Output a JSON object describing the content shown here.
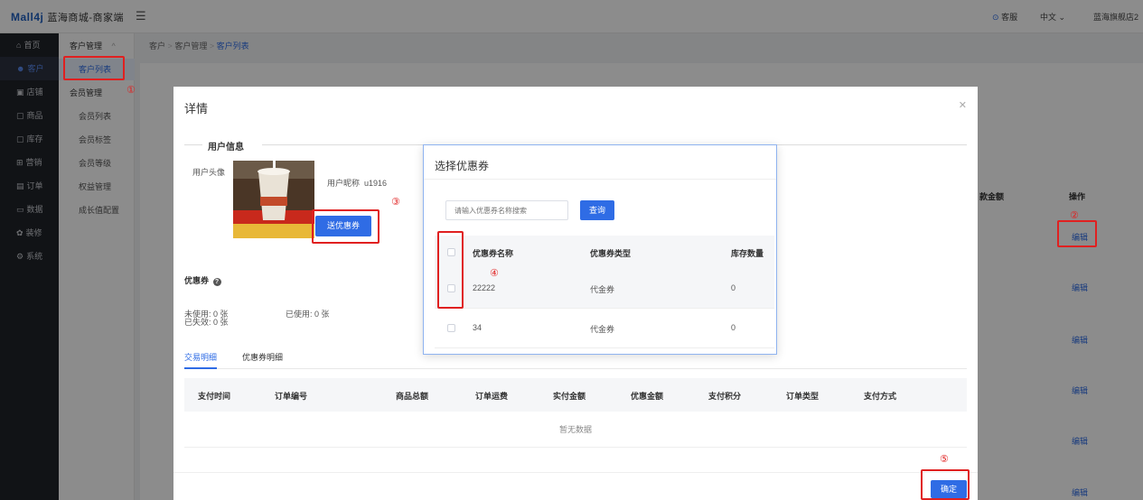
{
  "header": {
    "logo": "Mall4j",
    "app_name": "蓝海商城-商家端",
    "menu_icon": "hamburger-icon",
    "service": "客服",
    "language": "中文",
    "store": "蓝海旗舰店2"
  },
  "sidebar": {
    "items": [
      {
        "label": "首页",
        "icon": "home-icon"
      },
      {
        "label": "客户",
        "icon": "user-icon"
      },
      {
        "label": "店铺",
        "icon": "store-icon"
      },
      {
        "label": "商品",
        "icon": "goods-icon"
      },
      {
        "label": "库存",
        "icon": "stock-icon"
      },
      {
        "label": "营销",
        "icon": "gift-icon"
      },
      {
        "label": "订单",
        "icon": "order-icon"
      },
      {
        "label": "数据",
        "icon": "chart-icon"
      },
      {
        "label": "装修",
        "icon": "decorate-icon"
      },
      {
        "label": "系统",
        "icon": "settings-icon"
      }
    ]
  },
  "submenu": {
    "customer_manage": "客户管理",
    "customer_list": "客户列表",
    "member_manage": "会员管理",
    "member_list": "会员列表",
    "member_tags": "会员标签",
    "member_levels": "会员等级",
    "rights": "权益管理",
    "growth": "成长值配置"
  },
  "breadcrumb": [
    "客户",
    "客户管理",
    "客户列表"
  ],
  "background_table": {
    "amount_header": "款金额",
    "action_header": "操作",
    "edit_label": "编辑"
  },
  "annotations": {
    "one": "①",
    "two": "②",
    "three": "③",
    "four": "④",
    "five": "⑤"
  },
  "detail_dialog": {
    "title": "详情",
    "section": "用户信息",
    "avatar_label": "用户头像",
    "nickname_label": "用户昵称",
    "nickname": "u1916",
    "send_coupon": "送优惠券",
    "coupon_title": "优惠券",
    "unused": "未使用: 0 张",
    "used": "已使用: 0 张",
    "expired": "已失效: 0 张",
    "tabs": [
      "交易明细",
      "优惠券明细"
    ],
    "columns": [
      "支付时间",
      "订单编号",
      "商品总额",
      "订单运费",
      "实付金额",
      "优惠金额",
      "支付积分",
      "订单类型",
      "支付方式"
    ],
    "no_data": "暂无数据",
    "confirm": "确定"
  },
  "coupon_dialog": {
    "title": "选择优惠券",
    "search_placeholder": "请输入优惠券名称搜索",
    "search_button": "查询",
    "columns": [
      "优惠券名称",
      "优惠券类型",
      "库存数量"
    ],
    "rows": [
      {
        "name": "22222",
        "type": "代金券",
        "stock": "0"
      },
      {
        "name": "34",
        "type": "代金券",
        "stock": "0"
      }
    ]
  },
  "colors": {
    "primary": "#2f6ce5",
    "annotation": "#e02020",
    "sidebar": "#1f2329"
  }
}
